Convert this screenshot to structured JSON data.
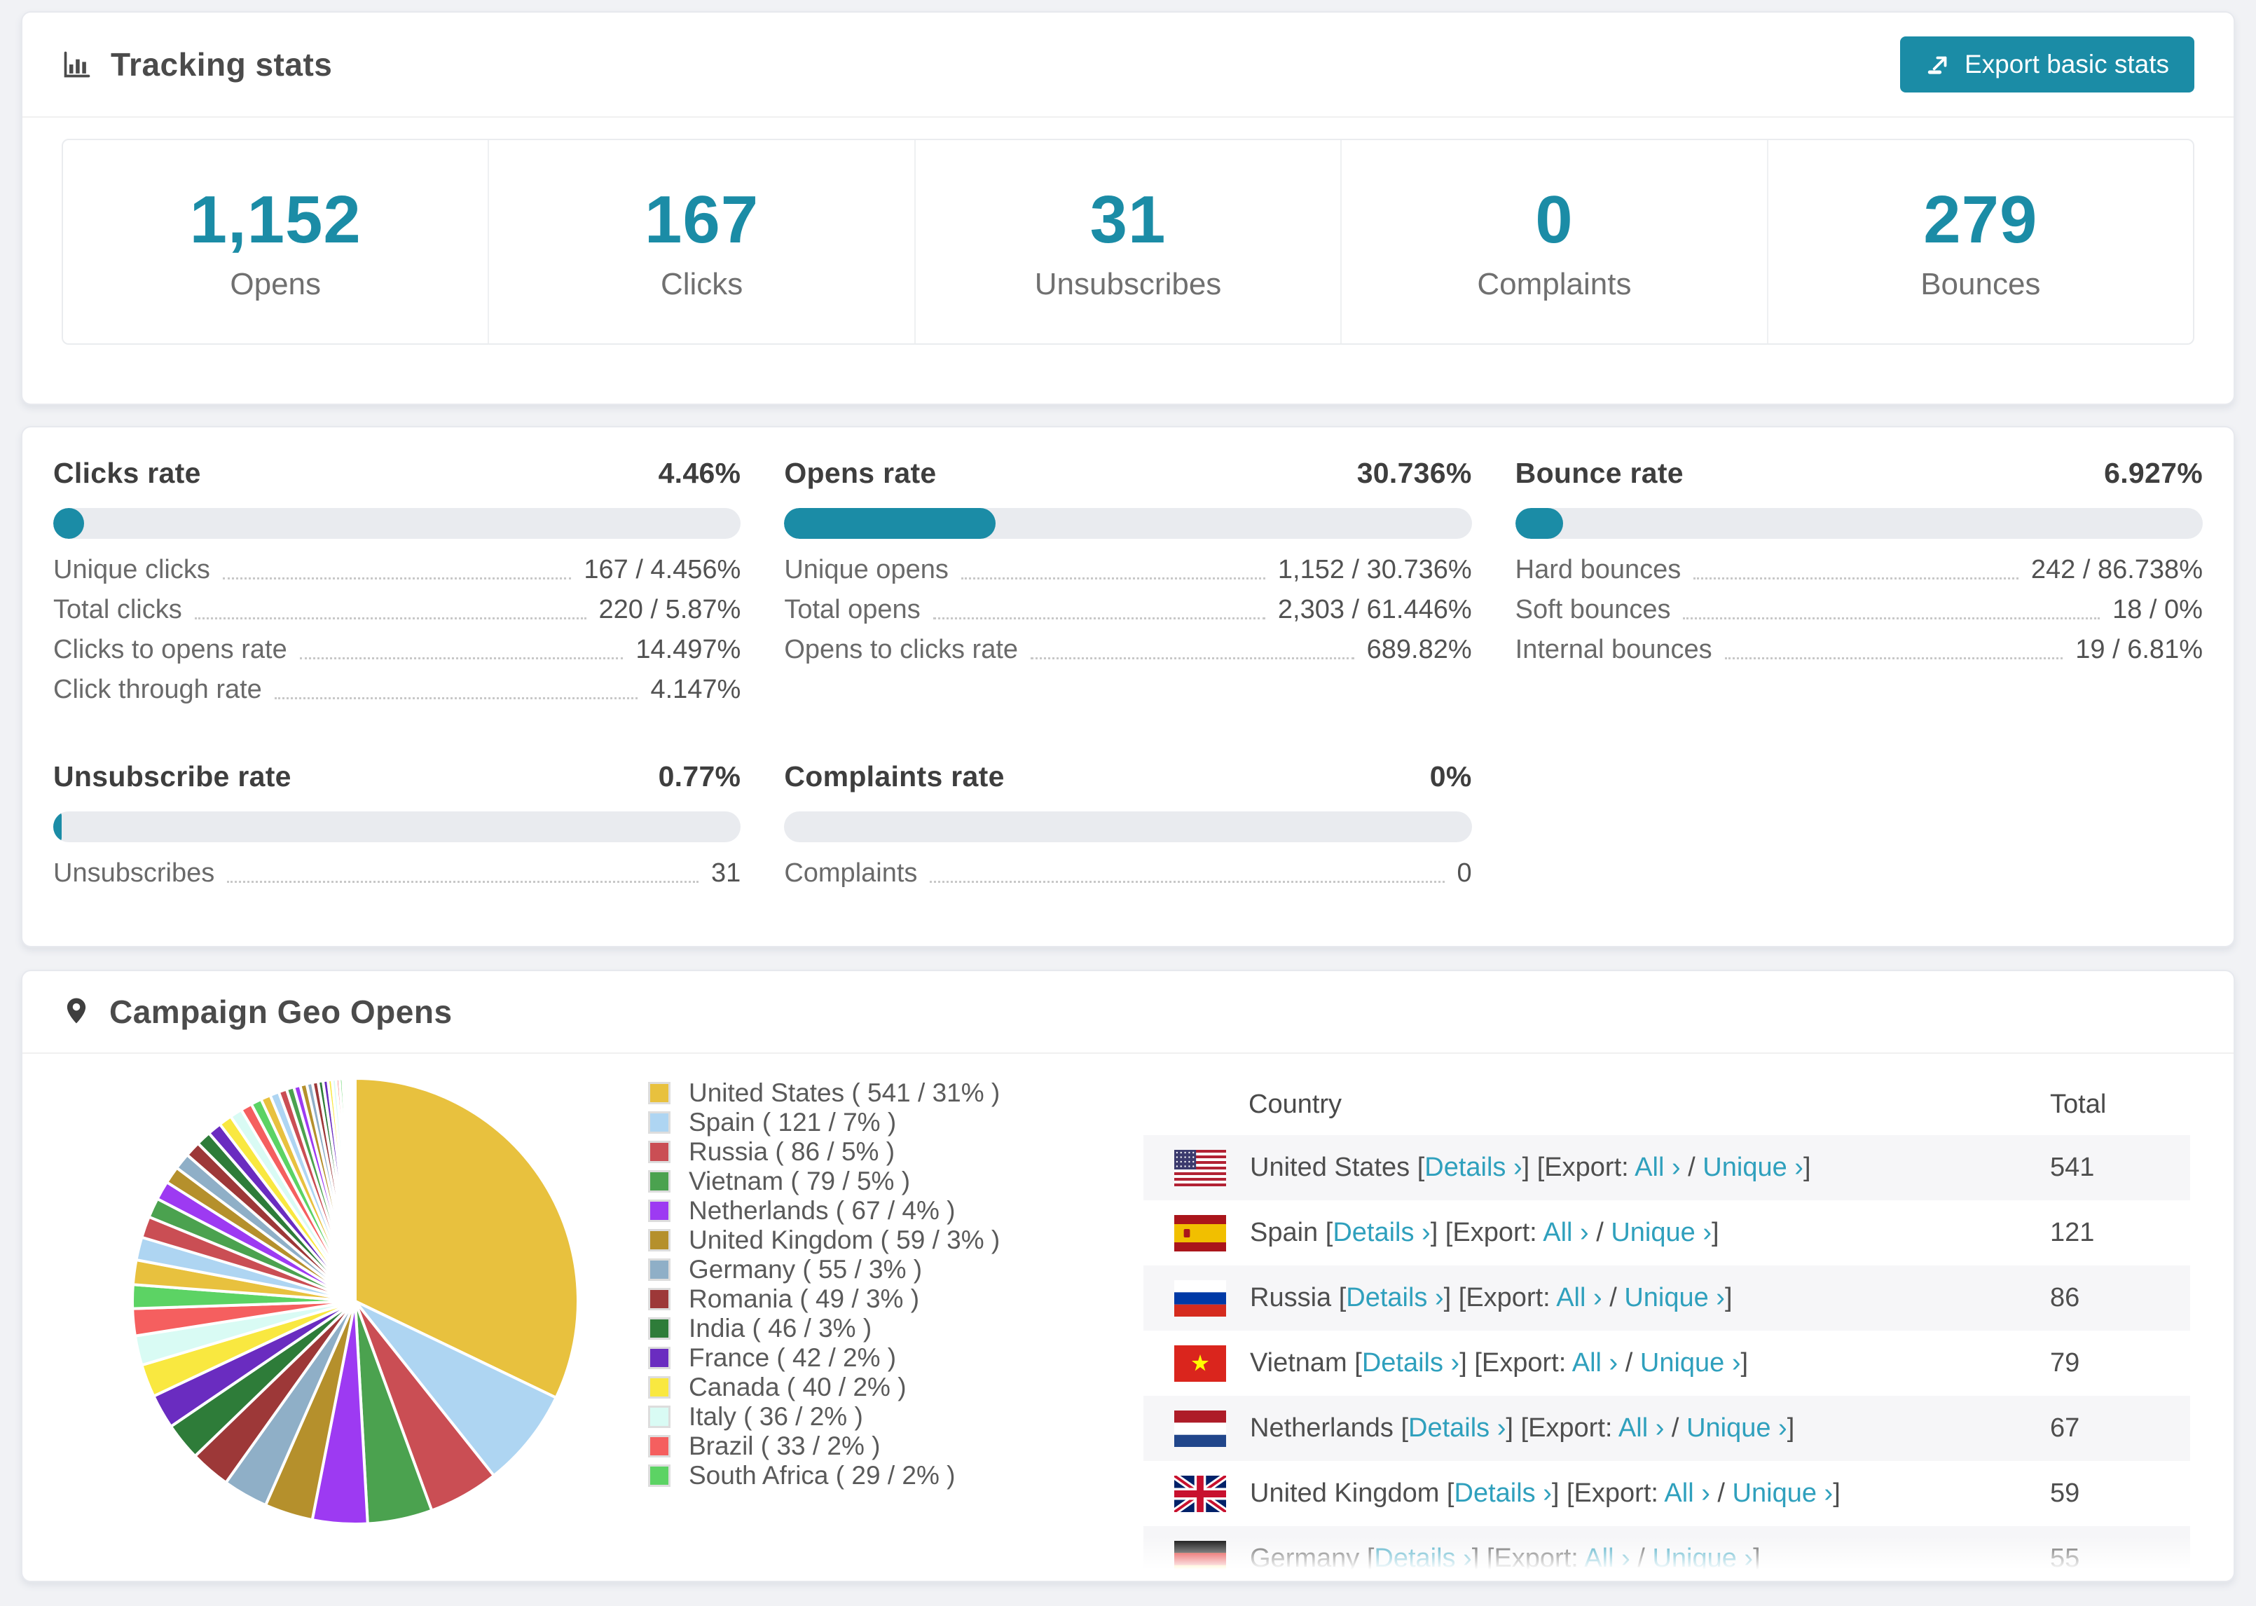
{
  "colors": {
    "accent": "#1b8ca6",
    "link": "#2fa0bd",
    "pie_palette": [
      "#e8c13e",
      "#aed5f2",
      "#ca4e54",
      "#4ba24f",
      "#9d3af2",
      "#b5902c",
      "#8fafc7",
      "#9d3838",
      "#2e7c39",
      "#6a2cc0",
      "#f9e840",
      "#d9fbf4",
      "#f55f5f",
      "#5cd364"
    ]
  },
  "header": {
    "title": "Tracking stats",
    "export_button": "Export basic stats"
  },
  "summary": [
    {
      "value": "1,152",
      "label": "Opens"
    },
    {
      "value": "167",
      "label": "Clicks"
    },
    {
      "value": "31",
      "label": "Unsubscribes"
    },
    {
      "value": "0",
      "label": "Complaints"
    },
    {
      "value": "279",
      "label": "Bounces"
    }
  ],
  "rates": [
    {
      "title": "Clicks rate",
      "value": "4.46%",
      "bar_pct": 4.46,
      "rows": [
        {
          "label": "Unique clicks",
          "value": "167 / 4.456%"
        },
        {
          "label": "Total clicks",
          "value": "220 / 5.87%"
        },
        {
          "label": "Clicks to opens rate",
          "value": "14.497%"
        },
        {
          "label": "Click through rate",
          "value": "4.147%"
        }
      ]
    },
    {
      "title": "Opens rate",
      "value": "30.736%",
      "bar_pct": 30.736,
      "rows": [
        {
          "label": "Unique opens",
          "value": "1,152 / 30.736%"
        },
        {
          "label": "Total opens",
          "value": "2,303 / 61.446%"
        },
        {
          "label": "Opens to clicks rate",
          "value": "689.82%"
        }
      ]
    },
    {
      "title": "Bounce rate",
      "value": "6.927%",
      "bar_pct": 6.927,
      "rows": [
        {
          "label": "Hard bounces",
          "value": "242 / 86.738%"
        },
        {
          "label": "Soft bounces",
          "value": "18 / 0%"
        },
        {
          "label": "Internal bounces",
          "value": "19 / 6.81%"
        }
      ]
    },
    {
      "title": "Unsubscribe rate",
      "value": "0.77%",
      "bar_pct": 0.77,
      "rows": [
        {
          "label": "Unsubscribes",
          "value": "31"
        }
      ]
    },
    {
      "title": "Complaints rate",
      "value": "0%",
      "bar_pct": 0,
      "rows": [
        {
          "label": "Complaints",
          "value": "0"
        }
      ]
    }
  ],
  "geo": {
    "title": "Campaign Geo Opens",
    "table": {
      "columns": [
        "Country",
        "Total"
      ],
      "links": {
        "details": "Details ›",
        "export_prefix": "[Export: ",
        "all": "All ›",
        "unique": "Unique ›"
      },
      "rows": [
        {
          "country": "United States",
          "flag": "us",
          "total": "541"
        },
        {
          "country": "Spain",
          "flag": "es",
          "total": "121"
        },
        {
          "country": "Russia",
          "flag": "ru",
          "total": "86"
        },
        {
          "country": "Vietnam",
          "flag": "vn",
          "total": "79"
        },
        {
          "country": "Netherlands",
          "flag": "nl",
          "total": "67"
        },
        {
          "country": "United Kingdom",
          "flag": "gb",
          "total": "59"
        },
        {
          "country": "Germany",
          "flag": "de",
          "total": "55",
          "partial": true
        }
      ]
    }
  },
  "chart_data": {
    "type": "pie",
    "title": "Campaign Geo Opens",
    "start_angle_deg": -90,
    "direction": "clockwise",
    "legend_position": "right",
    "slices": [
      {
        "name": "United States",
        "count": 541,
        "pct": 31
      },
      {
        "name": "Spain",
        "count": 121,
        "pct": 7
      },
      {
        "name": "Russia",
        "count": 86,
        "pct": 5
      },
      {
        "name": "Vietnam",
        "count": 79,
        "pct": 5
      },
      {
        "name": "Netherlands",
        "count": 67,
        "pct": 4
      },
      {
        "name": "United Kingdom",
        "count": 59,
        "pct": 3
      },
      {
        "name": "Germany",
        "count": 55,
        "pct": 3
      },
      {
        "name": "Romania",
        "count": 49,
        "pct": 3
      },
      {
        "name": "India",
        "count": 46,
        "pct": 3
      },
      {
        "name": "France",
        "count": 42,
        "pct": 2
      },
      {
        "name": "Canada",
        "count": 40,
        "pct": 2
      },
      {
        "name": "Italy",
        "count": 36,
        "pct": 2
      },
      {
        "name": "Brazil",
        "count": 33,
        "pct": 2
      },
      {
        "name": "South Africa",
        "count": 29,
        "pct": 2
      }
    ],
    "other_slices_estimated": [
      30,
      28,
      26,
      24,
      23,
      21,
      20,
      19,
      18,
      17,
      16,
      15,
      14,
      13,
      12,
      11,
      10,
      9,
      8,
      8,
      7,
      7,
      6,
      6,
      5,
      5,
      4,
      4,
      3,
      3,
      2,
      2,
      2,
      1,
      1,
      1
    ]
  }
}
